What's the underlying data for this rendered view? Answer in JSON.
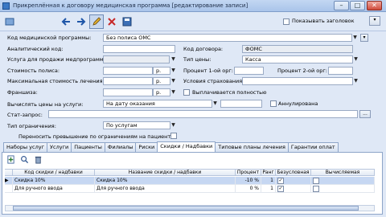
{
  "window": {
    "title": "Прикреплённая к договору медицинская программа [редактирование записи]"
  },
  "toolbar": {
    "show_header_label": "Показывать заголовок"
  },
  "form": {
    "med_program_label": "Код медицинской программы:",
    "med_program_value": "Без полиса ОМС",
    "analytic_code_label": "Аналитический код:",
    "contract_code_label": "Код договора:",
    "contract_code_value": "ФОМС",
    "service_label": "Услуга для продажи медпрограммы:",
    "price_type_label": "Тип цены:",
    "price_type_value": "Касса",
    "policy_cost_label": "Стоимость полиса:",
    "currency_r1": "р.",
    "org1_percent_label": "Процент 1-ой орг:",
    "org2_percent_label": "Процент 2-ой орг:",
    "max_cost_label": "Максимальная стоимость лечения:",
    "currency_r2": "р.",
    "insurance_terms_label": "Условия страхования:",
    "franchise_label": "Франшиза:",
    "currency_r3": "р.",
    "paid_fully_label": "Выплачивается полностью",
    "calc_prices_label": "Вычислять цены на услуги:",
    "calc_prices_value": "На дату оказания",
    "annulled_label": "Аннулирована",
    "stat_request_label": "Стат-запрос:",
    "restriction_type_label": "Тип ограничения:",
    "restriction_type_value": "По услугам",
    "transfer_excess_label": "Переносить превышение по ограничениям на пациента"
  },
  "tabs": [
    {
      "label": "Наборы услуг"
    },
    {
      "label": "Услуги"
    },
    {
      "label": "Пациенты"
    },
    {
      "label": "Филиалы"
    },
    {
      "label": "Риски"
    },
    {
      "label": "Скидки / Надбавки"
    },
    {
      "label": "Типовые планы лечения"
    },
    {
      "label": "Гарантии оплат"
    }
  ],
  "grid": {
    "columns": [
      "Код скидки / надбавки",
      "Название скидки / надбавки",
      "Процент",
      "Ранг",
      "Безусловная",
      "Вычисляемая"
    ],
    "rows": [
      {
        "code": "Скидка 10%",
        "name": "Скидка 10%",
        "percent": "-10 %",
        "rank": "1",
        "unconditional": true,
        "computed": false
      },
      {
        "code": "Для ручного ввода",
        "name": "Для ручного ввода",
        "percent": "0 %",
        "rank": "1",
        "unconditional": true,
        "computed": false
      }
    ]
  },
  "colors": {
    "accent": "#3a78c4",
    "selection": "#c6d7f2"
  }
}
